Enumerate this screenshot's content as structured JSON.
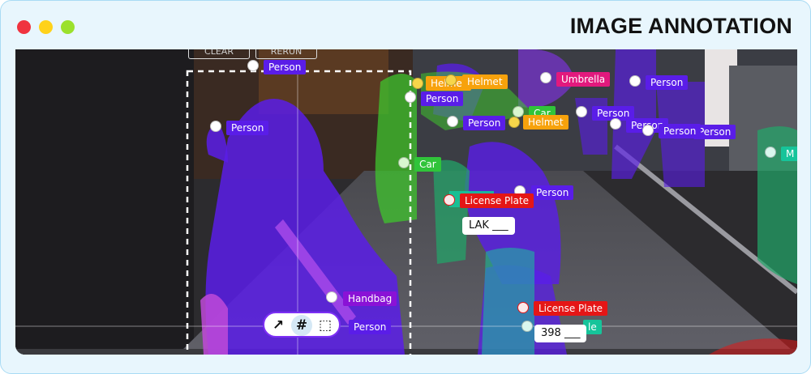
{
  "window": {
    "title": "IMAGE ANNOTATION",
    "controls": {
      "close_color": "#f0333f",
      "minimize_color": "#ffd21a",
      "maximize_color": "#9be12c"
    }
  },
  "canvas": {
    "top_buttons": [
      "CLEAR",
      "RERUN"
    ],
    "text_fields": [
      {
        "name": "license-plate-text-1",
        "value": "LAK ___"
      },
      {
        "name": "license-plate-text-2",
        "value": "398 ___"
      }
    ],
    "labels": [
      {
        "text": "Person",
        "color": "#5a1de8"
      },
      {
        "text": "Person",
        "color": "#5a1de8"
      },
      {
        "text": "Helmet",
        "color": "#f7a20c"
      },
      {
        "text": "Helmet",
        "color": "#f7a20c"
      },
      {
        "text": "Helmet",
        "color": "#f7a20c"
      },
      {
        "text": "Umbrella",
        "color": "#e2197d"
      },
      {
        "text": "Person",
        "color": "#5a1de8"
      },
      {
        "text": "Person",
        "color": "#5a1de8"
      },
      {
        "text": "Car",
        "color": "#30c43a"
      },
      {
        "text": "Person",
        "color": "#5a1de8"
      },
      {
        "text": "Person",
        "color": "#5a1de8"
      },
      {
        "text": "Person",
        "color": "#5a1de8"
      },
      {
        "text": "Person",
        "color": "#5a1de8"
      },
      {
        "text": "Person",
        "color": "#5a1de8"
      },
      {
        "text": "Car",
        "color": "#30c43a"
      },
      {
        "text": "License Plate",
        "color": "#e51616"
      },
      {
        "text": "Person",
        "color": "#5a1de8"
      },
      {
        "text": "M",
        "color": "#16c49a"
      },
      {
        "text": "Handbag",
        "color": "#8a12d6"
      },
      {
        "text": "Person",
        "color": "#5a1de8"
      },
      {
        "text": "License Plate",
        "color": "#e51616"
      },
      {
        "text": "le",
        "color": "#16c49a"
      }
    ],
    "toolbar": {
      "tools": [
        {
          "icon": "arrow-up-right-icon",
          "glyph": "↗"
        },
        {
          "icon": "hash-icon",
          "glyph": "#"
        },
        {
          "icon": "dashed-box-icon",
          "glyph": "⬚"
        }
      ]
    }
  }
}
